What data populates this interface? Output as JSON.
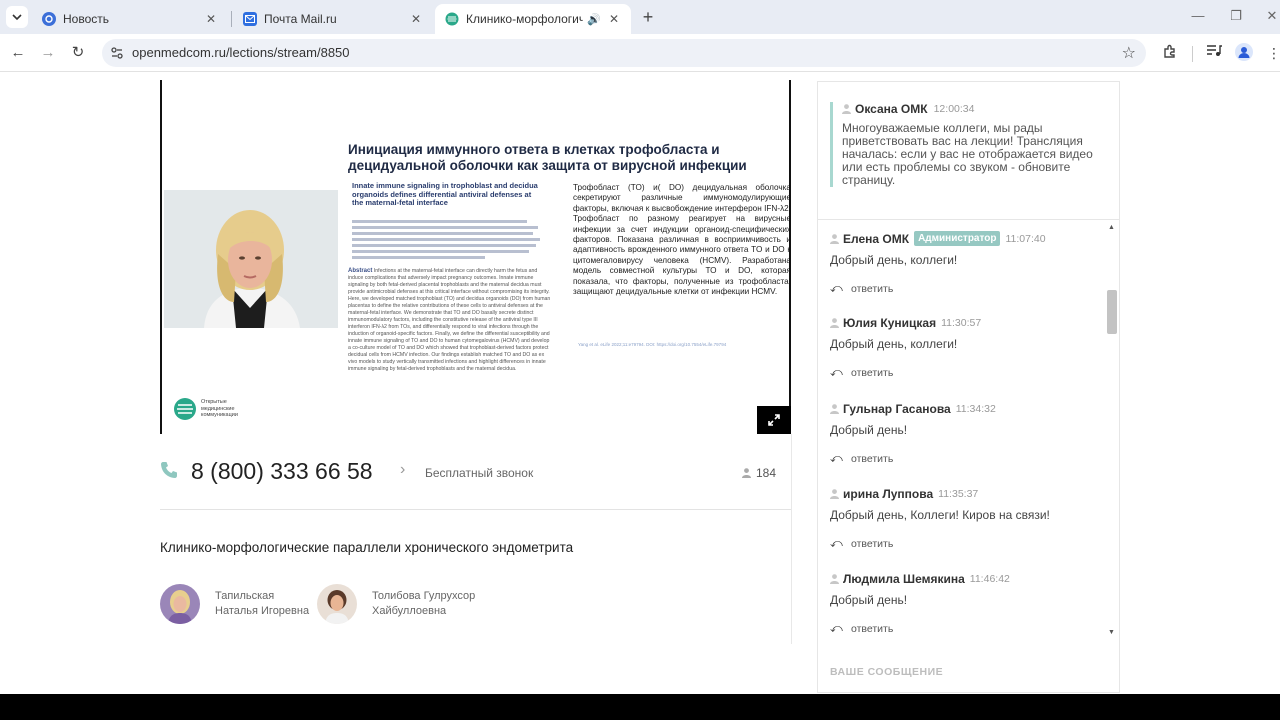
{
  "browser": {
    "tabs": [
      {
        "label": "Новость",
        "active": false
      },
      {
        "label": "Почта Mail.ru",
        "active": false
      },
      {
        "label": "Клинико-морфологическ",
        "active": true
      }
    ],
    "url": "openmedcom.ru/lections/stream/8850"
  },
  "slide": {
    "title": "Инициация иммунного ответа в клетках  трофобласта и децидуальной оболочки как защита от вирусной инфекции",
    "paper_heading": "Innate immune signaling in trophoblast and decidua organoids defines differential antiviral defenses at the maternal-fetal interface",
    "abstract_label": "Abstract",
    "abstract_text": "Infections at the maternal-fetal interface can directly harm the fetus and induce complications that adversely impact pregnancy outcomes. Innate immune signaling by both fetal-derived placental trophoblasts and the maternal decidua must provide antimicrobial defenses at this critical interface without compromising its integrity. Here, we developed matched trophoblast (TO) and decidua organoids (DO) from human placentas to define the relative contributions of these cells to antiviral defenses at the maternal-fetal interface. We demonstrate that TO and DO basally secrete distinct immunomodulatory factors, including the constitutive release of the antiviral type III interferon IFN-λ2 from TOs, and differentially respond to viral infections through the induction of organoid-specific factors. Finally, we define the differential susceptibility and innate immune signaling of TO and DO to human cytomegalovirus (HCMV) and develop a co-culture model of TO and DO which showed that trophoblast-derived factors protect decidual cells from HCMV infection. Our findings establish matched TO and DO as ex vivo models to study vertically transmitted infections and highlight differences in innate immune signaling by fetal-derived trophoblasts and the maternal decidua.",
    "body_text": "Трофобласт (TO)  и( DO) децидуальная оболочка секретируют различные иммуномодулирующие факторы, включая к высвобождение интерферон IFN-λ2.  Трофобласт  по разному реагирует на вирусные инфекции за счет индукции органоид-специфических факторов.   Показана различная в восприимчивость   и   адаптивность   врожденного иммунного ответа   TO и DO к цитомегаловирусу человека  (HCMV).      Разработана  модель совместной культуры ТО и DO, которая показала, что   факторы,   полученные   из   трофобласта, защищают  децидуальные  клетки  от  инфекции HCMV.",
    "reference": "Yang et al. eLife 2022;11:e79794. DOI: https://doi.org/10.7554/eLife.79794",
    "logo_text": "Открытые медицинские коммуникации"
  },
  "phone": {
    "number": "8 (800) 333 66 58",
    "free_call_label": "Бесплатный звонок",
    "viewers_count": "184"
  },
  "lecture": {
    "title": "Клинико-морфологические параллели хронического эндометрита",
    "authors": [
      {
        "first_line": "Тапильская",
        "second_line": "Наталья Игоревна"
      },
      {
        "first_line": "Толибова Гулрухсор",
        "second_line": "Хайбуллоевна"
      }
    ]
  },
  "chat": {
    "pinned": {
      "name": "Оксана ОМК",
      "time": "12:00:34",
      "text": "Многоуважаемые коллеги, мы рады приветствовать вас на лекции! Трансляция началась: если у вас не отображается видео или есть проблемы со звуком - обновите страницу."
    },
    "reply_label": "ответить",
    "messages": [
      {
        "name": "Елена ОМК",
        "badge": "Администратор",
        "time": "11:07:40",
        "text": "Добрый день, коллеги!"
      },
      {
        "name": "Юлия Куницкая",
        "badge": "",
        "time": "11:30:57",
        "text": "Добрый день, коллеги!"
      },
      {
        "name": "Гульнар Гасанова",
        "badge": "",
        "time": "11:34:32",
        "text": "Добрый день!"
      },
      {
        "name": "ирина Луппова",
        "badge": "",
        "time": "11:35:37",
        "text": "Добрый день, Коллеги! Киров на связи!"
      },
      {
        "name": "Людмила Шемякина",
        "badge": "",
        "time": "11:46:42",
        "text": "Добрый день!"
      }
    ],
    "compose_label": "ВАШЕ СООБЩЕНИЕ"
  },
  "colors": {
    "accent_teal": "#96c8c2",
    "pinned_border": "#a8d8d0",
    "logo_green": "#2aa88a"
  }
}
